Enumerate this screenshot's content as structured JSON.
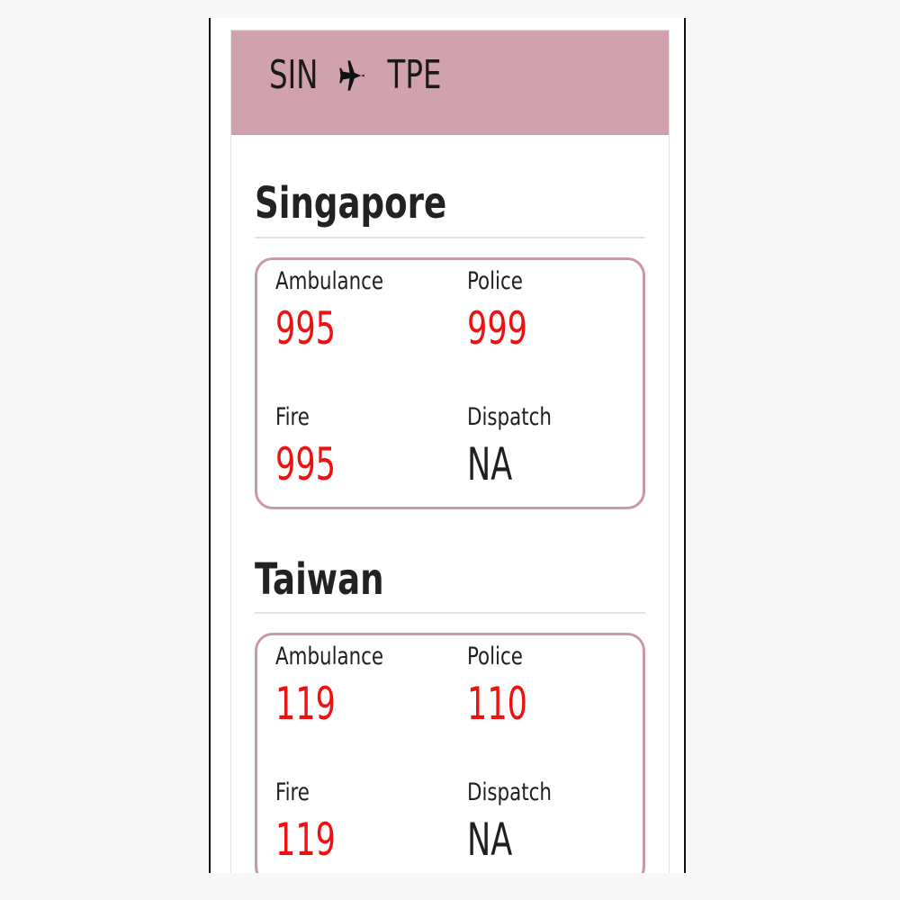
{
  "colors": {
    "header_bg": "#cfa2ae",
    "box_border": "#c99aa6",
    "emergency_red": "#ee1111",
    "neutral_value": "#1f1f1f"
  },
  "header": {
    "origin": "SIN",
    "destination": "TPE",
    "icon": "airplane-icon"
  },
  "countries": [
    {
      "name": "Singapore",
      "numbers": [
        {
          "label": "Ambulance",
          "value": "995",
          "highlight": true
        },
        {
          "label": "Police",
          "value": "999",
          "highlight": true
        },
        {
          "label": "Fire",
          "value": "995",
          "highlight": true
        },
        {
          "label": "Dispatch",
          "value": "NA",
          "highlight": false
        }
      ]
    },
    {
      "name": "Taiwan",
      "numbers": [
        {
          "label": "Ambulance",
          "value": "119",
          "highlight": true
        },
        {
          "label": "Police",
          "value": "110",
          "highlight": true
        },
        {
          "label": "Fire",
          "value": "119",
          "highlight": true
        },
        {
          "label": "Dispatch",
          "value": "NA",
          "highlight": false
        }
      ]
    }
  ]
}
